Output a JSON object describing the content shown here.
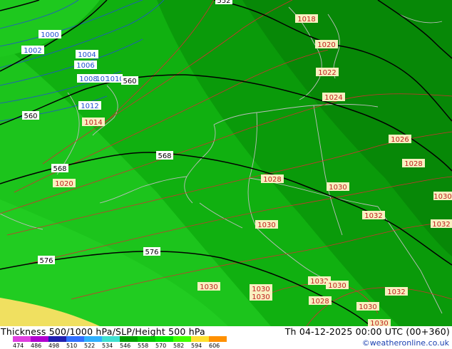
{
  "footer": {
    "title": "Thickness 500/1000 hPa/SLP/Height 500 hPa",
    "datetime": "Th 04-12-2025 00:00 UTC (00+360)",
    "copyright": "©weatheronline.co.uk",
    "scale_ticks": [
      "474",
      "486",
      "498",
      "510",
      "522",
      "534",
      "546",
      "558",
      "570",
      "582",
      "594",
      "606"
    ],
    "scale_colors": [
      "#e040e0",
      "#b000d0",
      "#2020b0",
      "#3070ff",
      "#30b0ff",
      "#40e0d0",
      "#00a000",
      "#00c800",
      "#00e600",
      "#40ff00",
      "#ffe030",
      "#ff9000"
    ]
  },
  "map": {
    "slp_labels_blue": [
      "1000",
      "1002",
      "1004",
      "1006",
      "1008",
      "1010",
      "1010",
      "1012"
    ],
    "slp_labels_red": [
      "1014",
      "1018",
      "1020",
      "1022",
      "1024",
      "1026",
      "1028",
      "1028",
      "1030",
      "1030",
      "1030",
      "1032",
      "1032",
      "1020",
      "1030",
      "1030",
      "1032",
      "1030",
      "1028",
      "1032",
      "1030",
      "1030",
      "1030"
    ],
    "height_labels": [
      "560",
      "560",
      "568",
      "568",
      "576",
      "576",
      "552"
    ],
    "colors": {
      "zone_light": "#1ec81e",
      "zone_mid": "#10b010",
      "zone_dark": "#0a9a0a",
      "zone_darker": "#078807",
      "zone_brightest": "#2ee42e",
      "sand": "#f0e060",
      "isobar_red": "#d03030",
      "isobar_blue": "#2050d0",
      "height_line": "#000000",
      "coast": "#bdbdbd"
    }
  }
}
